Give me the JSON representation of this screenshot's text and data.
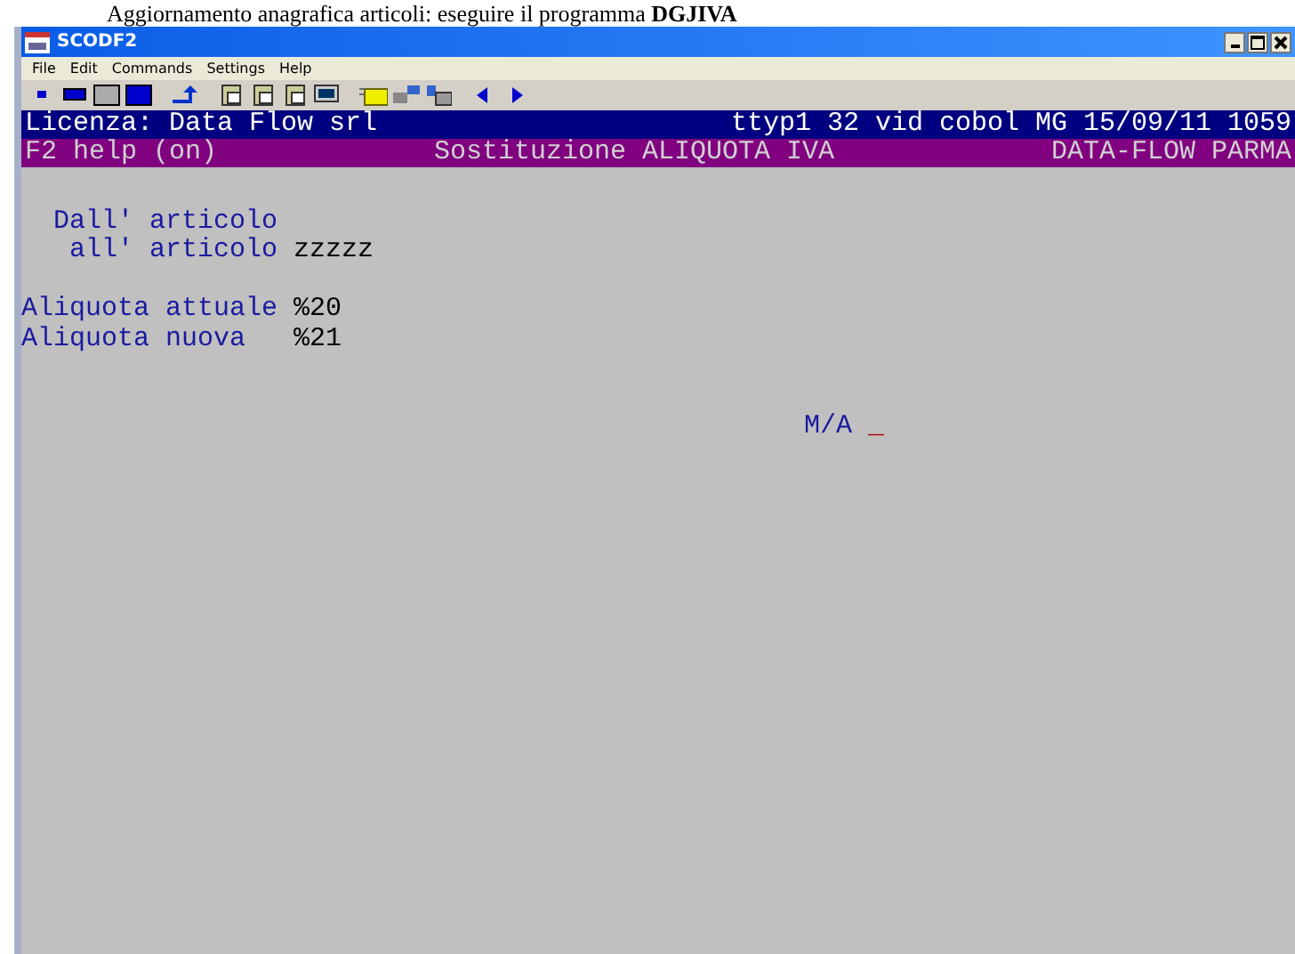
{
  "caption": "Aggiornamento anagrafica articoli: eseguire il programma **DGJIVA**",
  "window": {
    "title": "SCODF2"
  },
  "menu": [
    "File",
    "Edit",
    "Commands",
    "Settings",
    "Help"
  ],
  "status_line": {
    "left": "Licenza: Data Flow srl",
    "right": "ttyp1 32 vid cobol MG 15/09/11 1059"
  },
  "help_line": {
    "left": "F2 help (on)",
    "center": "Sostituzione ALIQUOTA IVA",
    "right": "DATA-FLOW PARMA"
  },
  "fields": [
    {
      "label": "  Dall' articolo"
    },
    {
      "label": "   all' articolo",
      "value": "zzzzz"
    },
    {
      "label": "Aliquota attuale",
      "value": "%20",
      "gap_before": true
    },
    {
      "label": "Aliquota nuova  ",
      "value": "%21"
    }
  ],
  "prompt": {
    "label": "M/A",
    "cursor": "_"
  }
}
